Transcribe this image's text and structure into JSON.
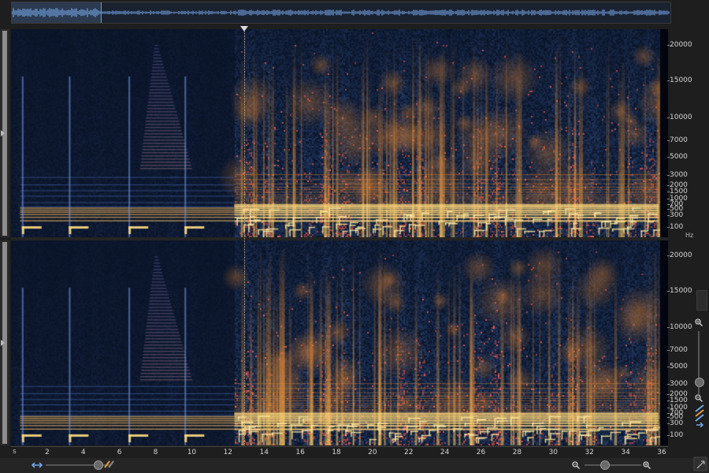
{
  "app": {
    "view": "spectrogram"
  },
  "colors": {
    "low": "#0b1c4a",
    "mid": "#2a4a8a",
    "high": "#e88a2a",
    "peak": "#fff0a8",
    "background": "#03060f"
  },
  "overview": {
    "selection_end_seconds": 4.9
  },
  "frequency_axis": {
    "unit": "Hz",
    "ticks": [
      "20000",
      "15000",
      "10000",
      "7000",
      "5000",
      "3000",
      "2000",
      "1500",
      "1000",
      "700",
      "500",
      "300",
      "100"
    ]
  },
  "time_axis": {
    "unit": "s",
    "ticks": [
      "2",
      "4",
      "6",
      "8",
      "10",
      "12",
      "14",
      "16",
      "18",
      "20",
      "22",
      "24",
      "26",
      "28",
      "30",
      "32",
      "34",
      "36"
    ]
  },
  "playhead": {
    "time_seconds": 12.9
  },
  "icons": {
    "scroll": "arrow-left-right-icon",
    "zoom_in": "zoom-in-icon",
    "zoom_out": "zoom-out-icon",
    "resize": "resize-corner-icon",
    "tools": "spectrum-tools-icon"
  },
  "sliders": {
    "horizontal_zoom_left": 0.8,
    "horizontal_zoom_right": 0.35,
    "vertical_zoom": 0.8
  }
}
